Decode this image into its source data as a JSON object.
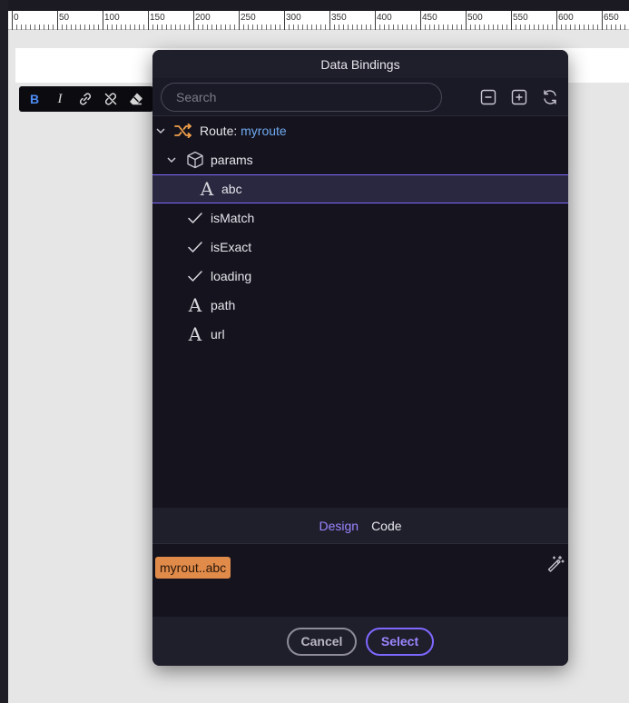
{
  "ruler": {
    "labels": [
      "0",
      "50",
      "100",
      "150",
      "200",
      "250",
      "300",
      "350",
      "400",
      "450",
      "500",
      "550",
      "600",
      "650"
    ]
  },
  "format_toolbar": {
    "items": [
      {
        "name": "bold",
        "glyph": "B"
      },
      {
        "name": "italic",
        "glyph": "I"
      },
      {
        "name": "link",
        "glyph": "link-icon"
      },
      {
        "name": "unlink",
        "glyph": "unlink-icon"
      },
      {
        "name": "clear-format",
        "glyph": "eraser-icon"
      }
    ]
  },
  "dialog": {
    "title": "Data Bindings",
    "search": {
      "placeholder": "Search",
      "value": ""
    },
    "actions": [
      "collapse-all-icon",
      "expand-all-icon",
      "refresh-icon"
    ],
    "tree": {
      "route": {
        "prefix": "Route:",
        "name": "myroute",
        "icon": "shuffle-icon"
      },
      "params": {
        "label": "params",
        "icon": "cube-icon"
      },
      "param_items": [
        {
          "label": "abc",
          "type": "string",
          "selected": true
        }
      ],
      "fields": [
        {
          "label": "isMatch",
          "type": "boolean"
        },
        {
          "label": "isExact",
          "type": "boolean"
        },
        {
          "label": "loading",
          "type": "boolean"
        },
        {
          "label": "path",
          "type": "string"
        },
        {
          "label": "url",
          "type": "string"
        }
      ]
    },
    "tabs": {
      "design": "Design",
      "code": "Code",
      "active": "design"
    },
    "expression": {
      "chip": "myrout..abc"
    },
    "footer": {
      "cancel": "Cancel",
      "select": "Select"
    }
  },
  "colors": {
    "accent": "#7d69ff",
    "chip": "#e08b4a",
    "route_name": "#6fa8f0",
    "route_icon": "#f0a04b",
    "bold_active": "#4d8df5"
  }
}
